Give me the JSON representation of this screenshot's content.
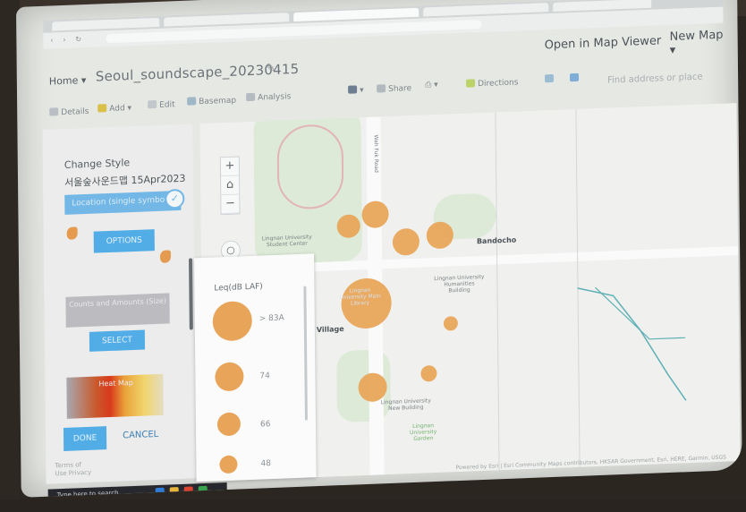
{
  "browser": {
    "tabs": [
      "",
      "",
      "",
      "",
      ""
    ]
  },
  "header": {
    "home": "Home ▾",
    "title": "Seoul_soundscape_20230415",
    "open_in_map_viewer": "Open in Map Viewer",
    "new_map": "New Map ▾"
  },
  "toolbar": {
    "details": "Details",
    "add": "Add ▾",
    "edit": "Edit",
    "basemap": "Basemap",
    "analysis": "Analysis",
    "share": "Share",
    "print": "⎙ ▾",
    "directions": "Directions",
    "find_address": "Find address or place"
  },
  "left_panel": {
    "title": "Change Style",
    "layer_name": "서울숲사운드맵 15Apr2023",
    "selected_attribute": "Location (single symbol)",
    "options_button": "OPTIONS",
    "secondary_card": "Counts and Amounts (Size)",
    "select_button": "SELECT",
    "heat_map_card": "Heat Map",
    "done_button": "DONE",
    "cancel_button": "CANCEL",
    "footer_line1": "Terms of",
    "footer_line2": "Use   Privacy"
  },
  "legend": {
    "title": "Leq(dB LAF)",
    "rows": [
      {
        "value": "> 83A"
      },
      {
        "value": "74"
      },
      {
        "value": "66"
      },
      {
        "value": "48"
      }
    ]
  },
  "map": {
    "labels": {
      "university_bldg": "Lingnan University Humanities Building",
      "student_center": "Lingnan University Student Center",
      "bondo": "Bandocho",
      "new_building": "Lingnan University New Building",
      "garden": "Lingnan University Garden",
      "village": "ord Village",
      "library": "Lingnan University Main Library",
      "road_name": "Wah Fuk Road"
    },
    "attribution": "Powered by Esri | Esri Community Maps contributors, HKSAR Government, Esri, HERE, Garmin, USGS"
  },
  "taskbar": {
    "search": "Type here to search"
  },
  "colors": {
    "accent": "#52ade6",
    "symbol": "#e8a55a",
    "park": "#dcead7",
    "river": "#5fb0b6"
  }
}
